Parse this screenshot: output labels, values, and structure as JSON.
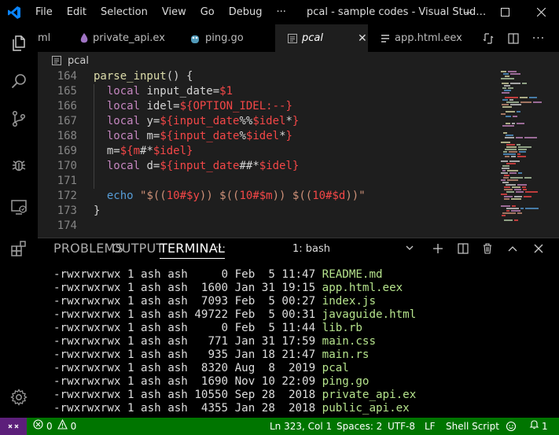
{
  "titlebar": {
    "menu": [
      "File",
      "Edit",
      "Selection",
      "View",
      "Go",
      "Debug",
      "···"
    ],
    "window_title": "pcal - sample codes - Visual Stud…"
  },
  "activity_bar": {
    "icons": [
      "explorer-icon",
      "search-icon",
      "source-control-icon",
      "debug-icon",
      "remote-explorer-icon",
      "extensions-icon",
      "settings-gear-icon"
    ]
  },
  "tabs": [
    {
      "label": "ml",
      "icon": "none"
    },
    {
      "label": "private_api.ex",
      "icon": "elixir-icon"
    },
    {
      "label": "ping.go",
      "icon": "go-gopher-icon"
    },
    {
      "label": "pcal",
      "icon": "file-icon",
      "active": true
    },
    {
      "label": "app.html.eex",
      "icon": "lines-icon"
    }
  ],
  "breadcrumb": {
    "label": "pcal"
  },
  "editor": {
    "line_numbers": [
      "164",
      "165",
      "166",
      "167",
      "168",
      "169",
      "170",
      "171",
      "172",
      "173",
      "174"
    ]
  },
  "panel": {
    "tabs": [
      "PROBLEMS",
      "OUTPUT",
      "TERMINAL",
      "···"
    ],
    "active_tab": "TERMINAL",
    "terminal_select": "1: bash",
    "listing": [
      {
        "perm": "-rwxrwxrwx",
        "links": "1",
        "owner": "ash",
        "group": "ash",
        "size": "0",
        "month": "Feb",
        "day": "5",
        "time": "11:47",
        "name": "README.md"
      },
      {
        "perm": "-rwxrwxrwx",
        "links": "1",
        "owner": "ash",
        "group": "ash",
        "size": "1600",
        "month": "Jan",
        "day": "31",
        "time": "19:15",
        "name": "app.html.eex"
      },
      {
        "perm": "-rwxrwxrwx",
        "links": "1",
        "owner": "ash",
        "group": "ash",
        "size": "7093",
        "month": "Feb",
        "day": "5",
        "time": "00:27",
        "name": "index.js"
      },
      {
        "perm": "-rwxrwxrwx",
        "links": "1",
        "owner": "ash",
        "group": "ash",
        "size": "49722",
        "month": "Feb",
        "day": "5",
        "time": "00:31",
        "name": "javaguide.html"
      },
      {
        "perm": "-rwxrwxrwx",
        "links": "1",
        "owner": "ash",
        "group": "ash",
        "size": "0",
        "month": "Feb",
        "day": "5",
        "time": "11:44",
        "name": "lib.rb"
      },
      {
        "perm": "-rwxrwxrwx",
        "links": "1",
        "owner": "ash",
        "group": "ash",
        "size": "771",
        "month": "Jan",
        "day": "31",
        "time": "17:59",
        "name": "main.css"
      },
      {
        "perm": "-rwxrwxrwx",
        "links": "1",
        "owner": "ash",
        "group": "ash",
        "size": "935",
        "month": "Jan",
        "day": "18",
        "time": "21:47",
        "name": "main.rs"
      },
      {
        "perm": "-rwxrwxrwx",
        "links": "1",
        "owner": "ash",
        "group": "ash",
        "size": "8320",
        "month": "Aug",
        "day": "8",
        "time": "2019",
        "name": "pcal"
      },
      {
        "perm": "-rwxrwxrwx",
        "links": "1",
        "owner": "ash",
        "group": "ash",
        "size": "1690",
        "month": "Nov",
        "day": "10",
        "time": "22:09",
        "name": "ping.go"
      },
      {
        "perm": "-rwxrwxrwx",
        "links": "1",
        "owner": "ash",
        "group": "ash",
        "size": "10550",
        "month": "Sep",
        "day": "28",
        "time": "2018",
        "name": "private_api.ex"
      },
      {
        "perm": "-rwxrwxrwx",
        "links": "1",
        "owner": "ash",
        "group": "ash",
        "size": "4355",
        "month": "Jan",
        "day": "28",
        "time": "2018",
        "name": "public_api.ex"
      }
    ]
  },
  "statusbar": {
    "errors": "0",
    "warnings": "0",
    "cursor": "Ln 323, Col 1",
    "spaces": "Spaces: 2",
    "encoding": "UTF-8",
    "eol": "LF",
    "language": "Shell Script",
    "notifications": "1"
  },
  "colors": {
    "statusbar_bg": "#007500",
    "remote_bg": "#5c1f7a",
    "accent_blue": "#0a84ff",
    "terminal_filename": "#b5e38c"
  }
}
